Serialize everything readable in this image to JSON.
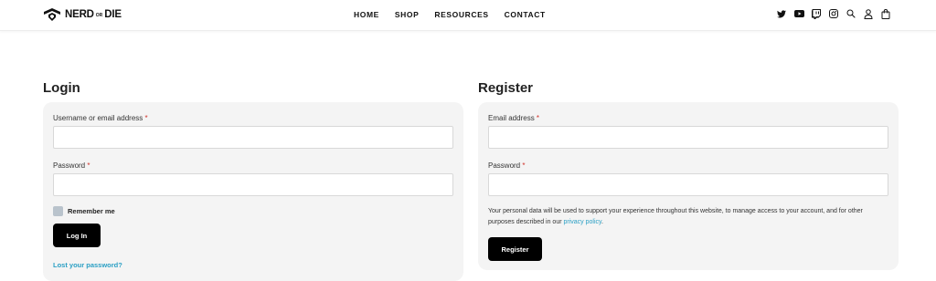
{
  "header": {
    "logo": {
      "part1": "NERD",
      "part2": "OR",
      "part3": "DIE"
    },
    "nav": [
      "HOME",
      "SHOP",
      "RESOURCES",
      "CONTACT"
    ],
    "icons": [
      "twitter-icon",
      "youtube-icon",
      "twitch-icon",
      "instagram-icon",
      "search-icon",
      "user-icon",
      "bag-icon"
    ]
  },
  "login": {
    "title": "Login",
    "username_label": "Username or email address",
    "password_label": "Password",
    "required_mark": "*",
    "remember_label": "Remember me",
    "button_label": "Log In",
    "lost_password": "Lost your password?"
  },
  "register": {
    "title": "Register",
    "email_label": "Email address",
    "password_label": "Password",
    "required_mark": "*",
    "privacy_text": "Your personal data will be used to support your experience throughout this website, to manage access to your account, and for other purposes described in our ",
    "privacy_link": "privacy policy",
    "privacy_end": ".",
    "button_label": "Register"
  },
  "colors": {
    "accent": "#2a9fc4",
    "required": "#d0342c",
    "button": "#000000",
    "card": "#f4f4f4"
  }
}
